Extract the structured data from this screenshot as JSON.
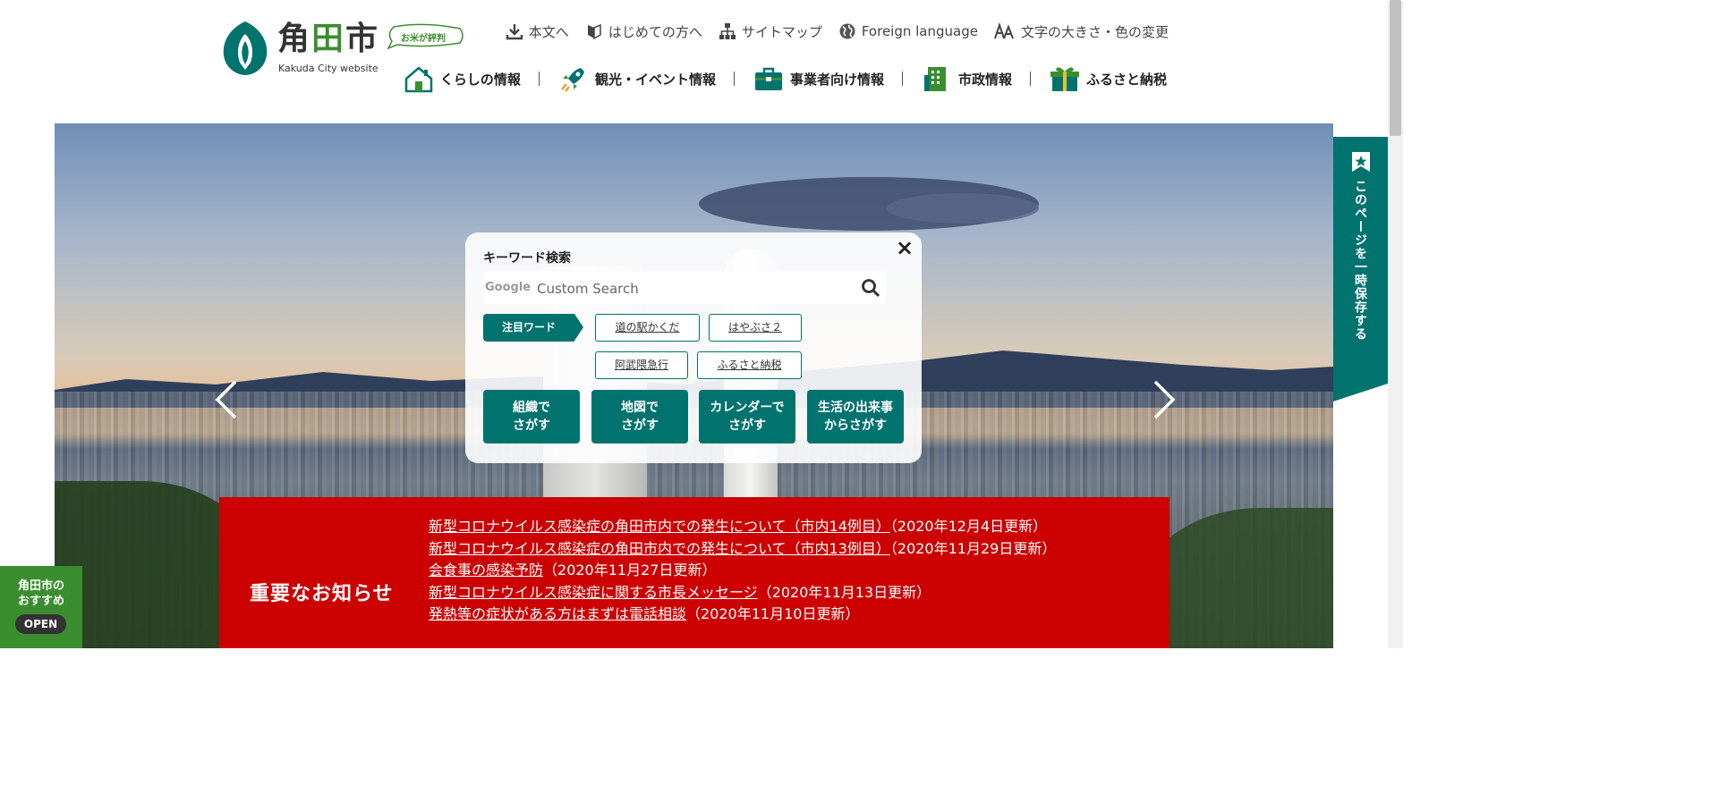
{
  "logo": {
    "name_1": "角",
    "name_2": "田",
    "name_3": "市",
    "subtitle": "Kakuda City website",
    "bubble": "お米が評判"
  },
  "utility_nav": [
    {
      "label": "本文へ",
      "icon": "download-arrow-icon"
    },
    {
      "label": "はじめての方へ",
      "icon": "beginner-mark-icon"
    },
    {
      "label": "サイトマップ",
      "icon": "sitemap-icon"
    },
    {
      "label": "Foreign language",
      "icon": "globe-icon"
    },
    {
      "label": "文字の大きさ・色の変更",
      "icon": "font-size-icon"
    }
  ],
  "global_nav": [
    {
      "label": "くらしの情報",
      "icon": "house-icon"
    },
    {
      "label": "観光・イベント情報",
      "icon": "rocket-icon"
    },
    {
      "label": "事業者向け情報",
      "icon": "briefcase-icon"
    },
    {
      "label": "市政情報",
      "icon": "building-icon"
    },
    {
      "label": "ふるさと納税",
      "icon": "gift-icon"
    }
  ],
  "search": {
    "title": "キーワード検索",
    "google_mark": "Google",
    "placeholder": "Custom Search",
    "hot_words_label": "注目ワード",
    "hot_words": [
      "道の駅かくだ",
      "はやぶさ２",
      "阿武隈急行",
      "ふるさと納税"
    ],
    "find_buttons": [
      "組織で\nさがす",
      "地図で\nさがす",
      "カレンダーで\nさがす",
      "生活の出来事\nからさがす"
    ],
    "close": "×"
  },
  "bookmark_tab": "このページを一時保存する",
  "notice": {
    "title": "重要なお知らせ",
    "items": [
      {
        "link": "新型コロナウイルス感染症の角田市内での発生について（市内14例目）",
        "date": "（2020年12月4日更新）"
      },
      {
        "link": "新型コロナウイルス感染症の角田市内での発生について（市内13例目）",
        "date": "（2020年11月29日更新）"
      },
      {
        "link": "会食事の感染予防",
        "date": "（2020年11月27日更新）"
      },
      {
        "link": "新型コロナウイルス感染症に関する市長メッセージ",
        "date": "（2020年11月13日更新）"
      },
      {
        "link": "発熱等の症状がある方はまずは電話相談",
        "date": "（2020年11月10日更新）"
      }
    ]
  },
  "recommend": {
    "label": "角田市の\nおすすめ",
    "open": "OPEN"
  },
  "colors": {
    "brand_teal": "#00736f",
    "brand_green": "#3a8e2f",
    "alert_red": "#cc0000"
  }
}
